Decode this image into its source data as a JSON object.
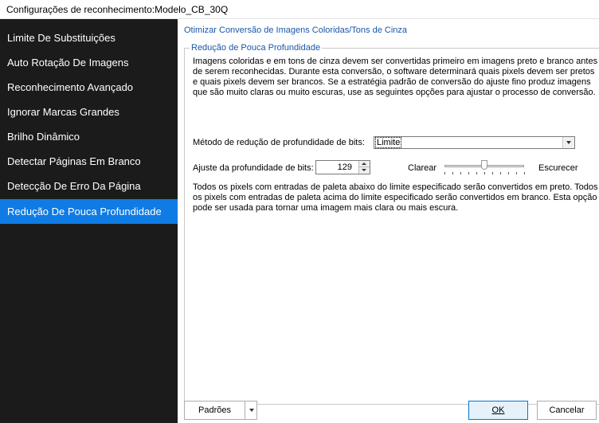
{
  "window": {
    "title": "Configurações de reconhecimento:Modelo_CB_30Q"
  },
  "sidebar": {
    "items": [
      {
        "label": "Limite De Substituições",
        "active": false
      },
      {
        "label": "Auto Rotação De Imagens",
        "active": false
      },
      {
        "label": "Reconhecimento Avançado",
        "active": false
      },
      {
        "label": "Ignorar Marcas Grandes",
        "active": false
      },
      {
        "label": "Brilho Dinâmico",
        "active": false
      },
      {
        "label": "Detectar Páginas Em Branco",
        "active": false
      },
      {
        "label": "Detecção De Erro Da Página",
        "active": false
      },
      {
        "label": "Redução De Pouca Profundidade",
        "active": true
      }
    ]
  },
  "main": {
    "heading": "Otimizar Conversão de Imagens Coloridas/Tons de Cinza",
    "group_title": "Redução de Pouca Profundidade",
    "description": "Imagens coloridas e em tons de cinza devem ser convertidas primeiro em imagens preto e branco antes de serem reconhecidas. Durante esta conversão, o software determinará quais pixels devem ser pretos e quais pixels devem ser brancos. Se a estratégia padrão de conversão do ajuste fino produz imagens que são muito claras ou muito escuras, use as seguintes opções para ajustar o processo de conversão.",
    "method_label": "Método de redução de profundidade de bits:",
    "method_value": "Limite",
    "depth_label": "Ajuste da profundidade de bits:",
    "depth_value": "129",
    "lighten_label": "Clarear",
    "darken_label": "Escurecer",
    "slider_level": 0.5,
    "threshold_note": "Todos os pixels com entradas de paleta abaixo do limite especificado serão convertidos em preto. Todos os pixels com entradas de paleta acima do limite especificado serão convertidos em branco. Esta opção pode ser usada para tornar uma imagem mais clara ou mais escura."
  },
  "footer": {
    "defaults_label": "Padrões",
    "ok_label": "OK",
    "cancel_label": "Cancelar"
  },
  "colors": {
    "sidebar_bg": "#1b1b1b",
    "accent": "#0f7be4",
    "heading": "#1a56a8"
  }
}
